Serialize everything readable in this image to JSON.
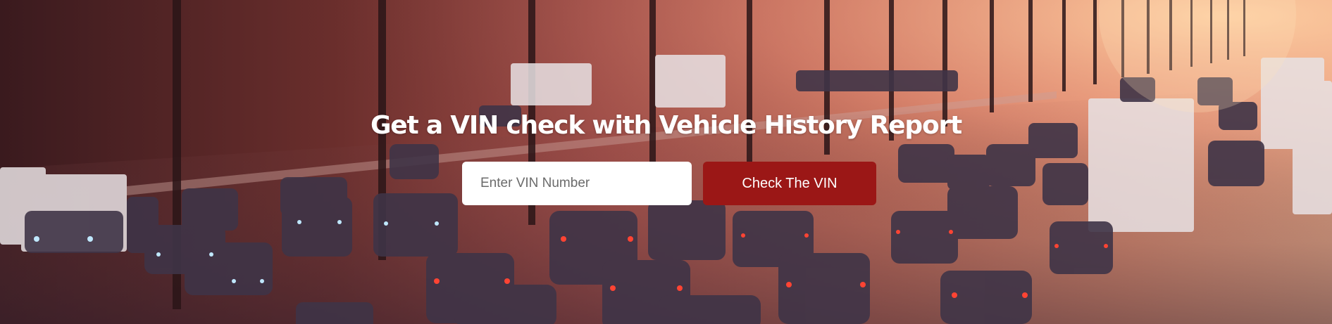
{
  "hero": {
    "headline": "Get a VIN check with Vehicle History Report",
    "background_image": "highway-traffic-sunset-photo"
  },
  "vin_form": {
    "input_placeholder": "Enter VIN Number",
    "input_value": "",
    "submit_label": "Check The VIN"
  },
  "colors": {
    "button": "#9b1716",
    "headline": "#ffffff",
    "input_bg": "#ffffff"
  }
}
